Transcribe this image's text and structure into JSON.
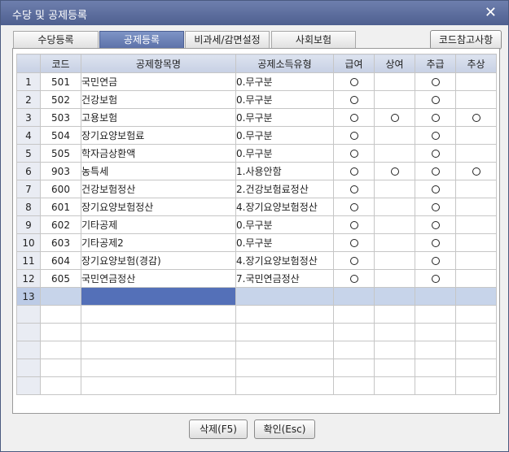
{
  "window": {
    "title": "수당 및 공제등록"
  },
  "tabs": [
    {
      "label": "수당등록",
      "active": false
    },
    {
      "label": "공제등록",
      "active": true
    },
    {
      "label": "비과세/감면설정",
      "active": false
    },
    {
      "label": "사회보험",
      "active": false
    }
  ],
  "code_ref_button": "코드참고사항",
  "grid": {
    "headers": [
      "",
      "코드",
      "공제항목명",
      "공제소득유형",
      "급여",
      "상여",
      "추급",
      "추상"
    ],
    "rows": [
      {
        "no": "1",
        "code": "501",
        "name": "국민연금",
        "type": "0.무구분",
        "marks": [
          true,
          false,
          true,
          false
        ]
      },
      {
        "no": "2",
        "code": "502",
        "name": "건강보험",
        "type": "0.무구분",
        "marks": [
          true,
          false,
          true,
          false
        ]
      },
      {
        "no": "3",
        "code": "503",
        "name": "고용보험",
        "type": "0.무구분",
        "marks": [
          true,
          true,
          true,
          true
        ]
      },
      {
        "no": "4",
        "code": "504",
        "name": "장기요양보험료",
        "type": "0.무구분",
        "marks": [
          true,
          false,
          true,
          false
        ]
      },
      {
        "no": "5",
        "code": "505",
        "name": "학자금상환액",
        "type": "0.무구분",
        "marks": [
          true,
          false,
          true,
          false
        ]
      },
      {
        "no": "6",
        "code": "903",
        "name": "농특세",
        "type": "1.사용안함",
        "marks": [
          true,
          true,
          true,
          true
        ]
      },
      {
        "no": "7",
        "code": "600",
        "name": "건강보험정산",
        "type": "2.건강보험료정산",
        "marks": [
          true,
          false,
          true,
          false
        ]
      },
      {
        "no": "8",
        "code": "601",
        "name": "장기요양보험정산",
        "type": "4.장기요양보험정산",
        "marks": [
          true,
          false,
          true,
          false
        ]
      },
      {
        "no": "9",
        "code": "602",
        "name": "기타공제",
        "type": "0.무구분",
        "marks": [
          true,
          false,
          true,
          false
        ]
      },
      {
        "no": "10",
        "code": "603",
        "name": "기타공제2",
        "type": "0.무구분",
        "marks": [
          true,
          false,
          true,
          false
        ]
      },
      {
        "no": "11",
        "code": "604",
        "name": "장기요양보험(경감)",
        "type": "4.장기요양보험정산",
        "marks": [
          true,
          false,
          true,
          false
        ]
      },
      {
        "no": "12",
        "code": "605",
        "name": "국민연금정산",
        "type": "7.국민연금정산",
        "marks": [
          true,
          false,
          true,
          false
        ]
      },
      {
        "no": "13",
        "code": "",
        "name": "",
        "type": "",
        "marks": [
          false,
          false,
          false,
          false
        ],
        "selected": true
      },
      {
        "no": "",
        "code": "",
        "name": "",
        "type": "",
        "marks": [
          false,
          false,
          false,
          false
        ]
      },
      {
        "no": "",
        "code": "",
        "name": "",
        "type": "",
        "marks": [
          false,
          false,
          false,
          false
        ]
      },
      {
        "no": "",
        "code": "",
        "name": "",
        "type": "",
        "marks": [
          false,
          false,
          false,
          false
        ]
      },
      {
        "no": "",
        "code": "",
        "name": "",
        "type": "",
        "marks": [
          false,
          false,
          false,
          false
        ]
      },
      {
        "no": "",
        "code": "",
        "name": "",
        "type": "",
        "marks": [
          false,
          false,
          false,
          false
        ]
      }
    ]
  },
  "buttons": {
    "delete": "삭제(F5)",
    "ok": "확인(Esc)"
  },
  "colors": {
    "titlebar": "#5a6b9c",
    "active_tab": "#6b80b6",
    "selection": "#5470b8"
  }
}
